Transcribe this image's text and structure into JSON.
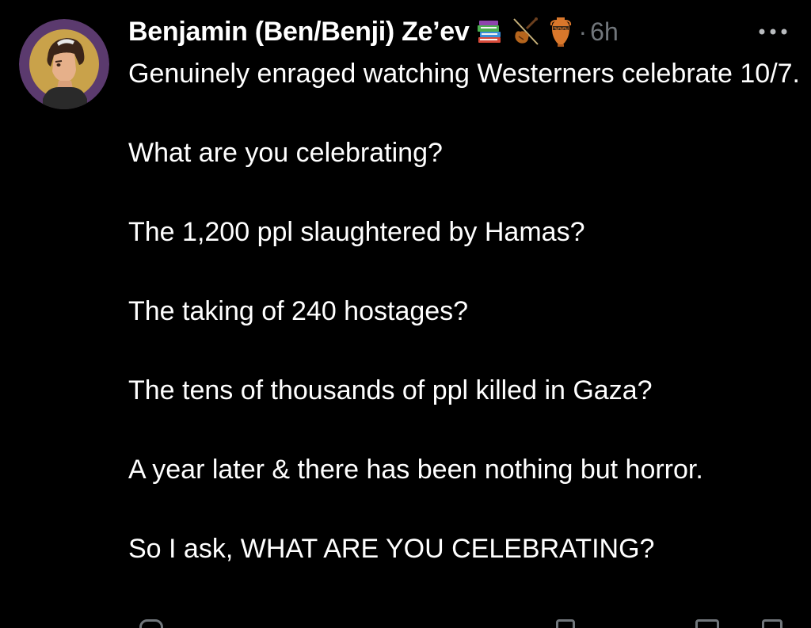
{
  "post": {
    "author": {
      "display_name": "Benjamin (Ben/Benji) Ze’ev",
      "emoji_icons": [
        "books-emoji-icon",
        "violin-emoji-icon",
        "amphora-emoji-icon"
      ]
    },
    "separator": "·",
    "timestamp": "6h",
    "more_icon": "more-horizontal-icon",
    "paragraphs": [
      "Genuinely enraged watching Westerners celebrate 10/7.",
      "What are you celebrating?",
      "The 1,200 ppl slaughtered by Hamas?",
      "The taking of 240 hostages?",
      "The tens of thousands of ppl killed in Gaza?",
      "A year later & there has been nothing but horror.",
      "So I ask, WHAT ARE YOU CELEBRATING?"
    ]
  },
  "colors": {
    "background": "#000000",
    "text_primary": "#ffffff",
    "text_secondary": "#71767b",
    "avatar_ring": "#5b3a6e",
    "avatar_inner": "#c9a24a"
  }
}
